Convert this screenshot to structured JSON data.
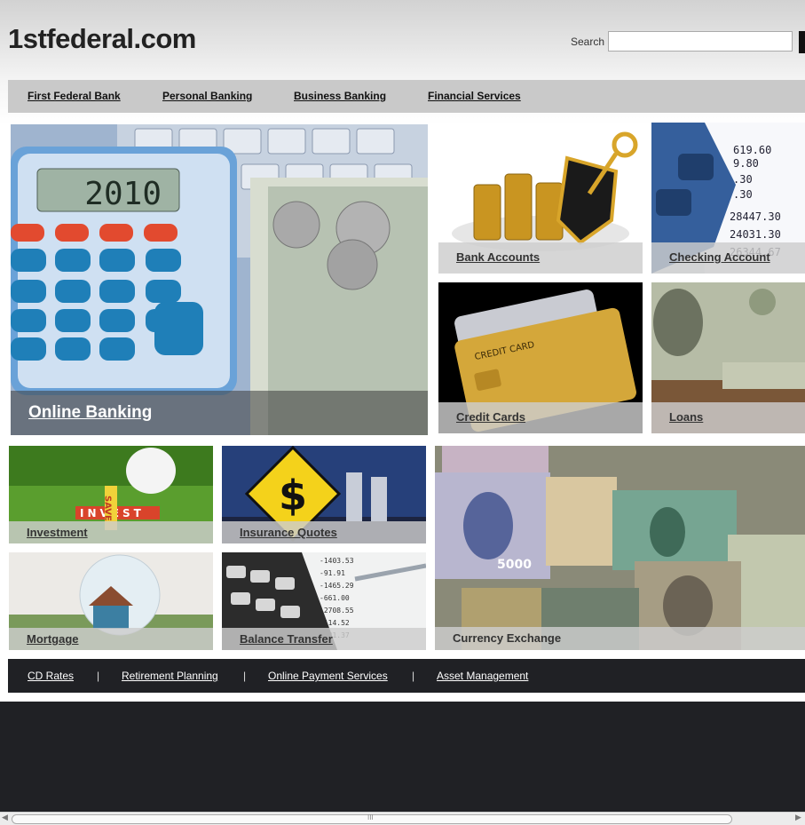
{
  "site": {
    "logo": "1stfederal.com"
  },
  "search": {
    "label": "Search",
    "value": "",
    "placeholder": ""
  },
  "nav": {
    "items": [
      "First Federal Bank",
      "Personal Banking",
      "Business Banking",
      "Financial Services"
    ]
  },
  "tiles": {
    "online_banking": "Online Banking",
    "bank_accounts": "Bank Accounts",
    "checking_account": "Checking Account",
    "credit_cards": "Credit Cards",
    "loans": "Loans",
    "investment": "Investment",
    "insurance_quotes": "Insurance Quotes",
    "mortgage": "Mortgage",
    "balance_transfer": "Balance Transfer",
    "currency_exchange": "Currency Exchange"
  },
  "imagery": {
    "calculator_display": "2010",
    "credit_card_text": "CREDIT CARD",
    "bill_value": "5000",
    "piggy_letters": "INVEST",
    "save_letters": "SAVE"
  },
  "footer": {
    "links": [
      "CD Rates",
      "Retirement Planning",
      "Online Payment Services",
      "Asset Management"
    ],
    "separator": "|"
  },
  "scrollbar": {
    "grip": "III"
  },
  "colors": {
    "nav_bg": "#c9c9c9",
    "footer_bg": "#202125",
    "caption_bg": "#cdcdcd"
  }
}
